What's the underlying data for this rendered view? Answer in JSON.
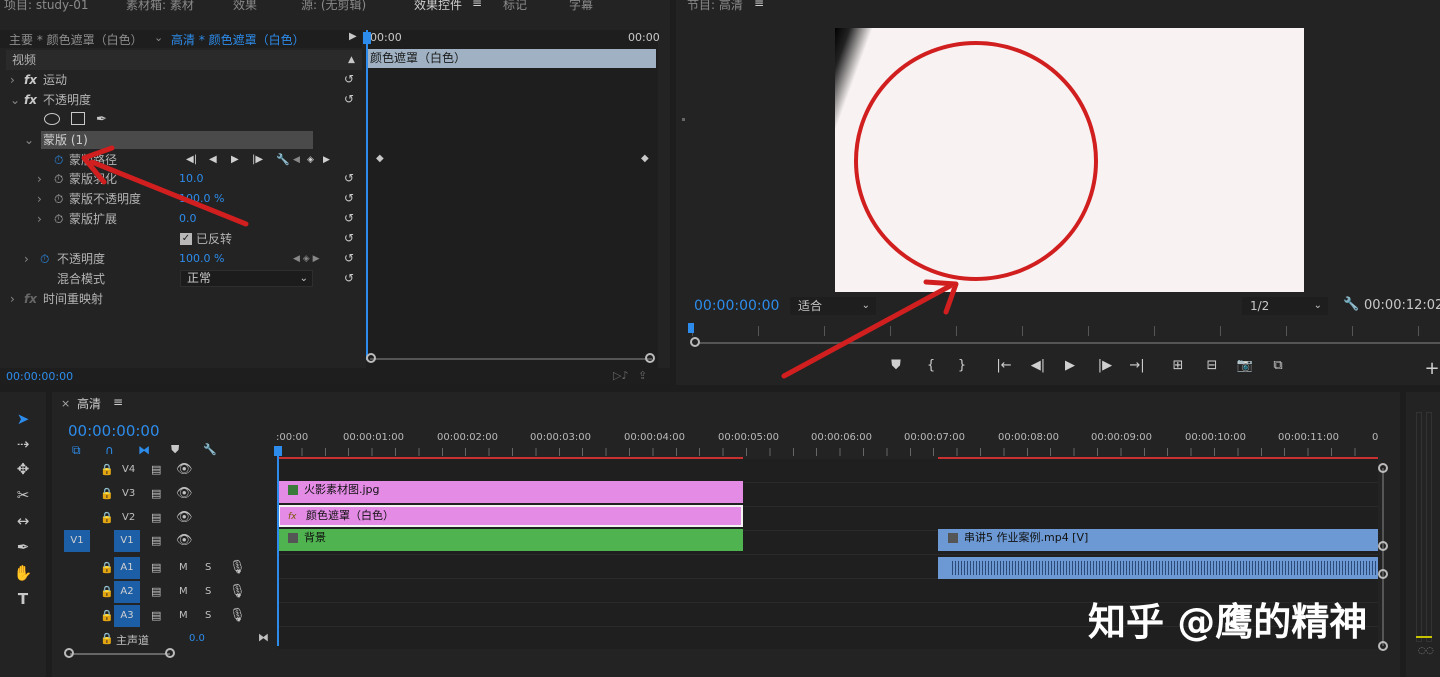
{
  "tabs": {
    "project": "项目: study-01",
    "bin": "素材箱: 素材",
    "effects": "效果",
    "source": "源: (无剪辑)",
    "effect_controls": "效果控件",
    "markers": "标记",
    "captions": "字幕",
    "program": "节目: 高清"
  },
  "ec": {
    "master": "主要 * 颜色遮罩（白色）",
    "clip": "高清 * 颜色遮罩（白色）",
    "time_start": "00:00",
    "time_end": "00:00",
    "clip_bar": "颜色遮罩（白色）",
    "video": "视频",
    "motion": "运动",
    "opacity": "不透明度",
    "mask": "蒙版 (1)",
    "mask_path": "蒙版路径",
    "mask_feather": "蒙版羽化",
    "mask_feather_val": "10.0",
    "mask_opacity": "蒙版不透明度",
    "mask_opacity_val": "100.0 %",
    "mask_expand": "蒙版扩展",
    "mask_expand_val": "0.0",
    "inverted": "已反转",
    "opacity2": "不透明度",
    "opacity2_val": "100.0 %",
    "blend": "混合模式",
    "blend_val": "正常",
    "remap": "时间重映射",
    "timecode": "00:00:00:00"
  },
  "program": {
    "timecode": "00:00:00:00",
    "fit": "适合",
    "res": "1/2",
    "duration": "00:00:12:02"
  },
  "timeline": {
    "tab": "高清",
    "timecode": "00:00:00:00",
    "ruler": [
      ":00:00",
      "00:00:01:00",
      "00:00:02:00",
      "00:00:03:00",
      "00:00:04:00",
      "00:00:05:00",
      "00:00:06:00",
      "00:00:07:00",
      "00:00:08:00",
      "00:00:09:00",
      "00:00:10:00",
      "00:00:11:00",
      "0"
    ],
    "tracks": {
      "v4": "V4",
      "v3": "V3",
      "v2": "V2",
      "v1": "V1",
      "v1src": "V1",
      "a1": "A1",
      "a2": "A2",
      "a3": "A3",
      "m": "M",
      "s": "S",
      "master": "主声道",
      "master_val": "0.0"
    },
    "clips": {
      "fire": "火影素材图.jpg",
      "mask": "颜色遮罩（白色）",
      "bg": "背景",
      "video": "串讲5 作业案例.mp4 [V]"
    }
  },
  "watermark": "知乎 @鹰的精神",
  "colors": {
    "accent": "#2d8ceb",
    "pink": "#e48be6",
    "green": "#4fb350",
    "blue_clip": "#6c99d4",
    "red": "#d11f1f"
  }
}
